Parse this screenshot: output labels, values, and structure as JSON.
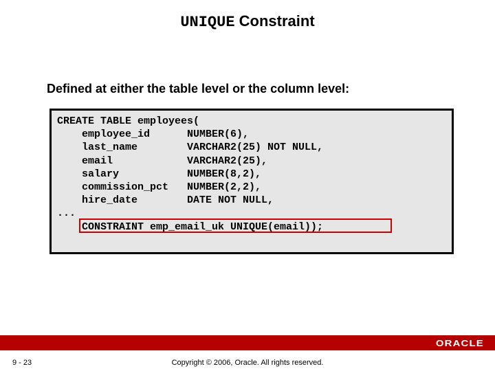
{
  "title": {
    "mono": "UNIQUE",
    "rest": " Constraint"
  },
  "subtitle": "Defined at either the table level or the column level:",
  "code": {
    "l1": "CREATE TABLE employees(",
    "l2": "    employee_id      NUMBER(6),",
    "l3": "    last_name        VARCHAR2(25) NOT NULL,",
    "l4": "    email            VARCHAR2(25),",
    "l5": "    salary           NUMBER(8,2),",
    "l6": "    commission_pct   NUMBER(2,2),",
    "l7": "    hire_date        DATE NOT NULL,",
    "l8": "...",
    "l9": "    CONSTRAINT emp_email_uk UNIQUE(email));"
  },
  "page_number": "9 - 23",
  "copyright": "Copyright © 2006, Oracle. All rights reserved.",
  "logo_text": "ORACLE"
}
